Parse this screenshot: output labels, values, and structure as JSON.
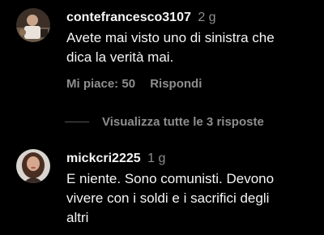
{
  "comments": [
    {
      "username": "contefrancesco3107",
      "time": "2 g",
      "lines": [
        "Avete mai visto uno di sinistra che",
        "dica la verità mai."
      ],
      "likes_label": "Mi piace: 50",
      "reply_label": "Rispondi"
    },
    {
      "username": "mickcri2225",
      "time": "1 g",
      "lines": [
        "E niente. Sono comunisti. Devono",
        "vivere con i soldi e i sacrifici degli",
        "altri"
      ]
    }
  ],
  "view_replies_label": "Visualizza tutte le 3 risposte",
  "colors": {
    "background": "#000000",
    "text_primary": "#f5f5f5",
    "text_secondary": "#8e8e8e"
  }
}
